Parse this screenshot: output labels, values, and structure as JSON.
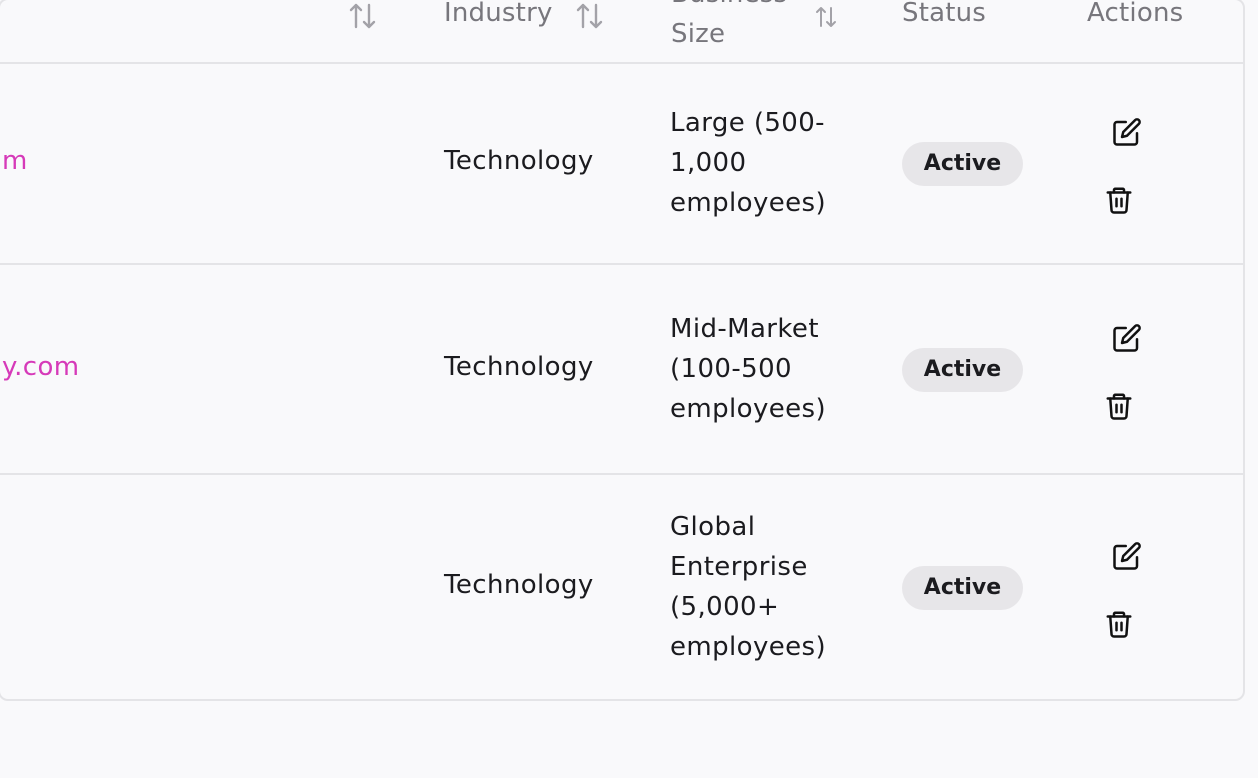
{
  "header": {
    "industry": "Industry",
    "business_size_line1": "Business",
    "business_size_line2": "Size",
    "status": "Status",
    "actions": "Actions"
  },
  "icons": {
    "sort": "sort-arrows-icon",
    "edit": "edit-icon",
    "delete": "trash-icon"
  },
  "rows": [
    {
      "link_text": "m",
      "industry": "Technology",
      "size_lines": [
        "Large (500-",
        "1,000",
        "employees)"
      ],
      "status": "Active"
    },
    {
      "link_text": "y.com",
      "industry": "Technology",
      "size_lines": [
        "Mid-Market",
        "(100-500",
        "employees)"
      ],
      "status": "Active"
    },
    {
      "link_text": "",
      "industry": "Technology",
      "size_lines": [
        "Global",
        "Enterprise",
        "(5,000+",
        "employees)"
      ],
      "status": "Active"
    }
  ],
  "colors": {
    "link": "#d63ab9",
    "badge_bg": "#e7e6e9",
    "border": "#e4e4e7",
    "header_text": "#77767c"
  }
}
